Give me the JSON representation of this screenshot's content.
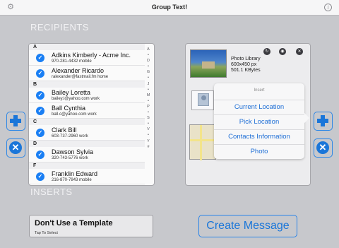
{
  "topbar": {
    "title": "Group Text!",
    "settings_icon": "gear-icon",
    "info_icon": "info-icon",
    "info_glyph": "i"
  },
  "labels": {
    "recipients": "RECIPIENTS",
    "inserts": "INSERTS"
  },
  "recipients": {
    "sections": [
      {
        "letter": "A",
        "contacts": [
          {
            "name": "Adkins Kimberly - Acme Inc.",
            "detail": "970-281-4432 mobile",
            "checked": true
          },
          {
            "name": "Alexander Ricardo",
            "detail": "ralexander@fastmail.fm home",
            "checked": true
          }
        ]
      },
      {
        "letter": "B",
        "contacts": [
          {
            "name": "Bailey Loretta",
            "detail": "bailey.l@yahoo.com work",
            "checked": true
          },
          {
            "name": "Ball Cynthia",
            "detail": "ball.c@yahoo.com work",
            "checked": true
          }
        ]
      },
      {
        "letter": "C",
        "contacts": [
          {
            "name": "Clark Bill",
            "detail": "603-737-2960 work",
            "checked": true
          }
        ]
      },
      {
        "letter": "D",
        "contacts": [
          {
            "name": "Dawson Sylvia",
            "detail": "320-743-5776 work",
            "checked": true
          }
        ]
      },
      {
        "letter": "F",
        "contacts": [
          {
            "name": "Franklin Edward",
            "detail": "216-870-7843 mobile",
            "checked": true
          }
        ]
      }
    ],
    "index_letters": [
      "A",
      "•",
      "D",
      "•",
      "G",
      "•",
      "J",
      "•",
      "M",
      "•",
      "P",
      "•",
      "S",
      "•",
      "V",
      "•",
      "Y",
      "#"
    ]
  },
  "buttons": {
    "add_glyph": "+",
    "remove_glyph": "✕"
  },
  "inserts_panel": {
    "toolbar_icons": [
      "close-circle-icon",
      "eye-icon",
      "delete-icon"
    ],
    "toolbar_glyphs": [
      "↻",
      "◉",
      "✕"
    ],
    "photo": {
      "source": "Photo Library",
      "size": "600x450 px",
      "bytes": "501.1 KBytes"
    }
  },
  "popover": {
    "title": "Insert",
    "items": [
      "Current Location",
      "Pick Location",
      "Contacts Information",
      "Photo"
    ]
  },
  "template": {
    "title": "Don't Use a Template",
    "subtitle": "Tap To Select"
  },
  "create": {
    "label": "Create Message"
  },
  "colors": {
    "accent": "#1a76d9",
    "background": "#c7c8cc"
  }
}
